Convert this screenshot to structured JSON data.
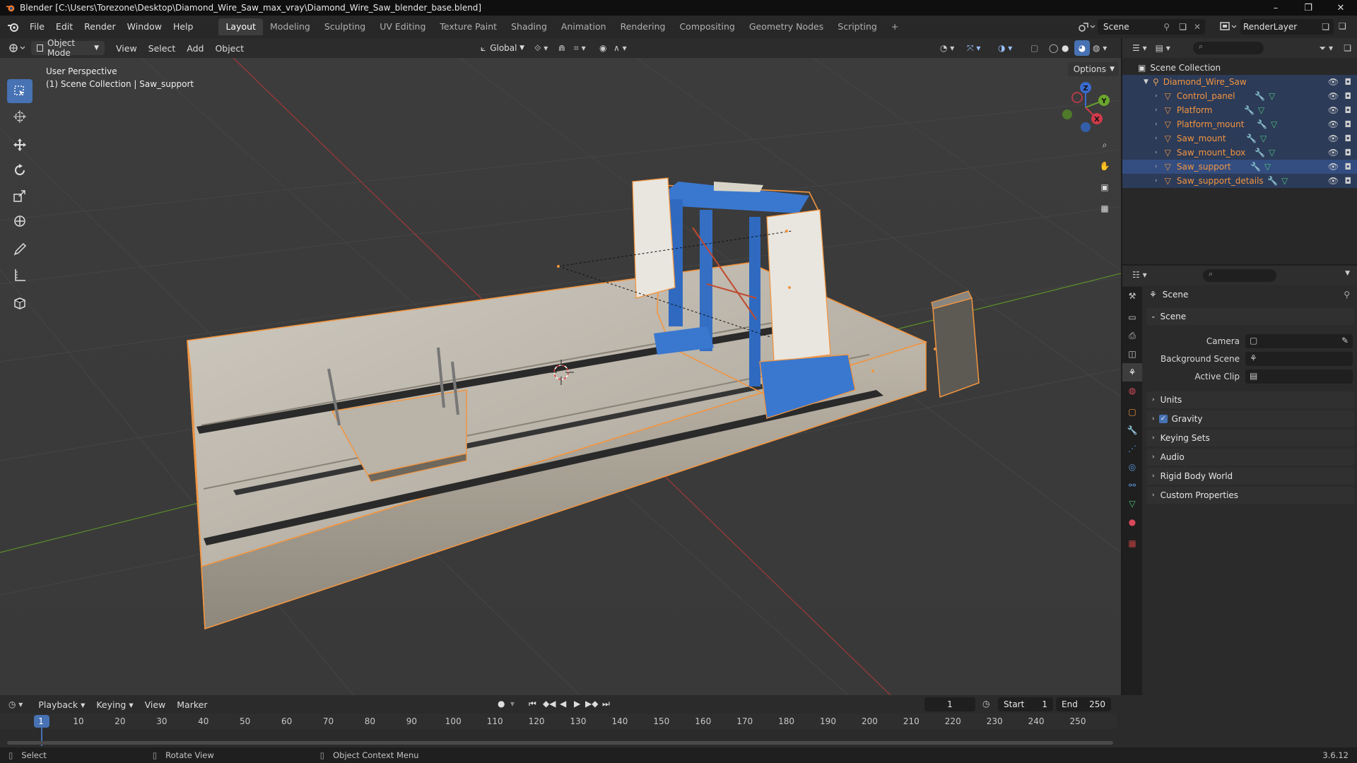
{
  "window": {
    "title": "Blender [C:\\Users\\Torezone\\Desktop\\Diamond_Wire_Saw_max_vray\\Diamond_Wire_Saw_blender_base.blend]",
    "minimize": "–",
    "maximize": "❐",
    "close": "✕"
  },
  "menu": [
    "File",
    "Edit",
    "Render",
    "Window",
    "Help"
  ],
  "workspaces": [
    {
      "label": "Layout",
      "active": true
    },
    {
      "label": "Modeling"
    },
    {
      "label": "Sculpting"
    },
    {
      "label": "UV Editing"
    },
    {
      "label": "Texture Paint"
    },
    {
      "label": "Shading"
    },
    {
      "label": "Animation"
    },
    {
      "label": "Rendering"
    },
    {
      "label": "Compositing"
    },
    {
      "label": "Geometry Nodes"
    },
    {
      "label": "Scripting"
    }
  ],
  "workspace_add": "+",
  "scene_name": "Scene",
  "view_layer": "RenderLayer",
  "viewport_header": {
    "mode": "Object Mode",
    "menus": [
      "View",
      "Select",
      "Add",
      "Object"
    ],
    "orientation": "Global",
    "options": "Options"
  },
  "viewport": {
    "perspective": "User Perspective",
    "context": "(1) Scene Collection | Saw_support",
    "gizmo": {
      "z": "Z",
      "y": "Y",
      "x": "X"
    }
  },
  "outliner": {
    "root": "Scene Collection",
    "collection": "Diamond_Wire_Saw",
    "objects": [
      "Control_panel",
      "Platform",
      "Platform_mount",
      "Saw_mount",
      "Saw_mount_box",
      "Saw_support",
      "Saw_support_details"
    ],
    "active_object": "Saw_support"
  },
  "properties": {
    "context": "Scene",
    "panel": "Scene",
    "fields": [
      {
        "label": "Camera",
        "value": ""
      },
      {
        "label": "Background Scene",
        "value": ""
      },
      {
        "label": "Active Clip",
        "value": ""
      }
    ],
    "panels": [
      "Units",
      "Gravity",
      "Keying Sets",
      "Audio",
      "Rigid Body World",
      "Custom Properties"
    ],
    "gravity_checked": true
  },
  "timeline": {
    "menus": [
      "Playback",
      "Keying",
      "View",
      "Marker"
    ],
    "current_frame": "1",
    "start_label": "Start",
    "start": "1",
    "end_label": "End",
    "end": "250",
    "ticks": [
      "1",
      "10",
      "20",
      "30",
      "40",
      "50",
      "60",
      "70",
      "80",
      "90",
      "100",
      "110",
      "120",
      "130",
      "140",
      "150",
      "160",
      "170",
      "180",
      "190",
      "200",
      "210",
      "220",
      "230",
      "240",
      "250"
    ]
  },
  "statusbar": {
    "select": "Select",
    "rotate": "Rotate View",
    "context_menu": "Object Context Menu",
    "version": "3.6.12"
  },
  "colors": {
    "accent_blue": "#4772b3",
    "selection": "#f29540",
    "active_row": "#334d80"
  }
}
